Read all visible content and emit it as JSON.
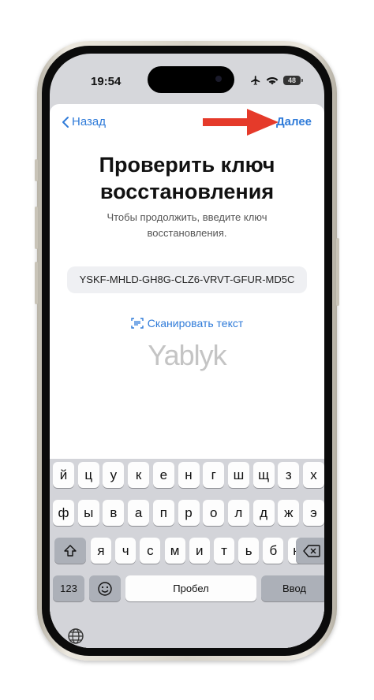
{
  "status": {
    "time": "19:54",
    "battery": "48"
  },
  "nav": {
    "back_label": "Назад",
    "next_label": "Далее"
  },
  "content": {
    "title_line1": "Проверить ключ",
    "title_line2": "восстановления",
    "subtitle_line1": "Чтобы продолжить, введите ключ",
    "subtitle_line2": "восстановления.",
    "recovery_key": "YSKF-MHLD-GH8G-CLZ6-VRVT-GFUR-MD5C",
    "scan_label": "Сканировать текст",
    "watermark": "Yablyk"
  },
  "keyboard": {
    "row1": [
      "й",
      "ц",
      "у",
      "к",
      "е",
      "н",
      "г",
      "ш",
      "щ",
      "з",
      "х"
    ],
    "row2": [
      "ф",
      "ы",
      "в",
      "а",
      "п",
      "р",
      "о",
      "л",
      "д",
      "ж",
      "э"
    ],
    "row3": [
      "я",
      "ч",
      "с",
      "м",
      "и",
      "т",
      "ь",
      "б",
      "ю"
    ],
    "numbers_label": "123",
    "space_label": "Пробел",
    "return_label": "Ввод"
  },
  "colors": {
    "accent": "#2f7bd9",
    "arrow": "#e53a2a"
  },
  "icons": {
    "back": "chevron-left-icon",
    "airplane": "airplane-icon",
    "wifi": "wifi-icon",
    "scan": "scan-text-icon",
    "shift": "shift-icon",
    "delete": "delete-icon",
    "emoji": "emoji-icon",
    "globe": "globe-icon"
  }
}
